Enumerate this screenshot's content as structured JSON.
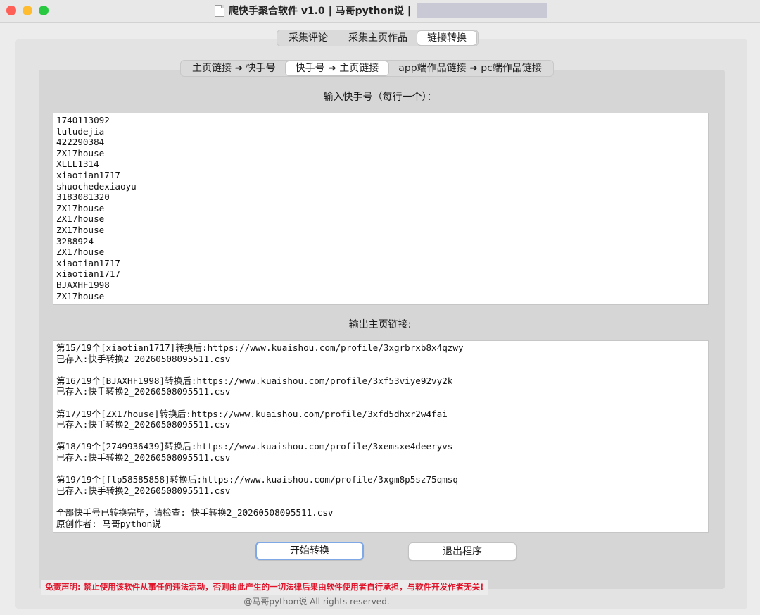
{
  "window": {
    "title": "爬快手聚合软件 v1.0 | 马哥python说 |"
  },
  "top_tabs": [
    {
      "label": "采集评论",
      "active": false
    },
    {
      "label": "采集主页作品",
      "active": false
    },
    {
      "label": "链接转换",
      "active": true
    }
  ],
  "sub_tabs": [
    {
      "label": "主页链接 ➜ 快手号",
      "active": false
    },
    {
      "label": "快手号 ➜ 主页链接",
      "active": true
    },
    {
      "label": "app端作品链接 ➜ pc端作品链接",
      "active": false
    }
  ],
  "input_section": {
    "label": "输入快手号（每行一个）：",
    "lines": [
      "1740113092",
      "luludejia",
      "422290384",
      "ZX17house",
      "XLLL1314",
      "xiaotian1717",
      "shuochedexiaoyu",
      "3183081320",
      "ZX17house",
      "ZX17house",
      "ZX17house",
      "3288924",
      "ZX17house",
      "xiaotian1717",
      "xiaotian1717",
      "BJAXHF1998",
      "ZX17house"
    ]
  },
  "output_section": {
    "label": "输出主页链接:",
    "lines": [
      "第15/19个[xiaotian1717]转换后:https://www.kuaishou.com/profile/3xgrbrxb8x4qzwy",
      "已存入:快手转换2_20260508095511.csv",
      "",
      "第16/19个[BJAXHF1998]转换后:https://www.kuaishou.com/profile/3xf53viye92vy2k",
      "已存入:快手转换2_20260508095511.csv",
      "",
      "第17/19个[ZX17house]转换后:https://www.kuaishou.com/profile/3xfd5dhxr2w4fai",
      "已存入:快手转换2_20260508095511.csv",
      "",
      "第18/19个[2749936439]转换后:https://www.kuaishou.com/profile/3xemsxe4deeryvs",
      "已存入:快手转换2_20260508095511.csv",
      "",
      "第19/19个[flp58585858]转换后:https://www.kuaishou.com/profile/3xgm8p5sz75qmsq",
      "已存入:快手转换2_20260508095511.csv",
      "",
      "全部快手号已转换完毕，请检查: 快手转换2_20260508095511.csv",
      "原创作者: 马哥python说"
    ]
  },
  "buttons": {
    "start": "开始转换",
    "exit": "退出程序"
  },
  "footer": {
    "disclaimer": "免责声明: 禁止使用该软件从事任何违法活动，否则由此产生的一切法律后果由软件使用者自行承担，与软件开发作者无关!",
    "copyright": "@马哥python说 All rights reserved."
  },
  "colors": {
    "disclaimer_text": "#e0142a",
    "active_button_border": "#7fa8e6"
  }
}
